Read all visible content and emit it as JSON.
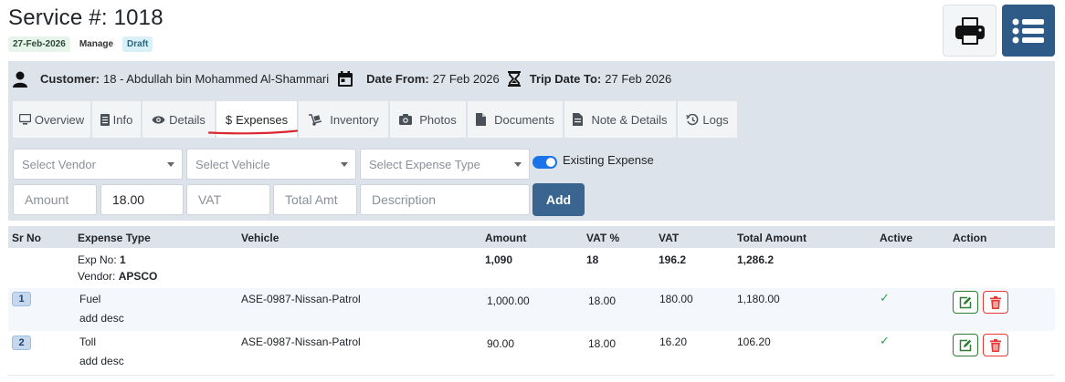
{
  "header": {
    "title": "Service #: 1018",
    "badges": {
      "date": "27-Feb-2026",
      "manage": "Manage",
      "status": "Draft"
    }
  },
  "info": {
    "customer_label": "Customer:",
    "customer_value": "18 - Abdullah bin Mohammed Al-Shammari",
    "date_from_label": "Date From:",
    "date_from_value": "27 Feb 2026",
    "trip_to_label": "Trip Date To:",
    "trip_to_value": "27 Feb 2026"
  },
  "tabs": [
    {
      "label": "Overview",
      "icon": "monitor-icon"
    },
    {
      "label": "Info",
      "icon": "document-icon"
    },
    {
      "label": "Details",
      "icon": "eye-icon"
    },
    {
      "label": "Expenses",
      "icon": "dollar-icon"
    },
    {
      "label": "Inventory",
      "icon": "dolly-icon"
    },
    {
      "label": "Photos",
      "icon": "camera-icon"
    },
    {
      "label": "Documents",
      "icon": "file-icon"
    },
    {
      "label": "Note & Details",
      "icon": "note-icon"
    },
    {
      "label": "Logs",
      "icon": "history-icon"
    }
  ],
  "form": {
    "vendor_placeholder": "Select Vendor",
    "vehicle_placeholder": "Select Vehicle",
    "expense_type_placeholder": "Select Expense Type",
    "existing_expense_label": "Existing Expense",
    "amount_placeholder": "Amount",
    "vat_percent_value": "18.00",
    "vat_placeholder": "VAT",
    "total_placeholder": "Total Amt",
    "description_placeholder": "Description",
    "add_label": "Add"
  },
  "table": {
    "columns": [
      "Sr No",
      "Expense Type",
      "Vehicle",
      "Amount",
      "VAT %",
      "VAT",
      "Total Amount",
      "Active",
      "Action"
    ],
    "group": {
      "exp_no_label": "Exp No:",
      "exp_no": "1",
      "vendor_label": "Vendor:",
      "vendor": "APSCO",
      "amount": "1,090",
      "vat_percent": "18",
      "vat": "196.2",
      "total": "1,286.2"
    },
    "rows": [
      {
        "sr": "1",
        "type": "Fuel",
        "desc": "add desc",
        "vehicle": "ASE-0987-Nissan-Patrol",
        "amount": "1,000.00",
        "vat_percent": "18.00",
        "vat": "180.00",
        "total": "1,180.00",
        "active": "✓"
      },
      {
        "sr": "2",
        "type": "Toll",
        "desc": "add desc",
        "vehicle": "ASE-0987-Nissan-Patrol",
        "amount": "90.00",
        "vat_percent": "18.00",
        "vat": "16.20",
        "total": "106.20",
        "active": "✓"
      }
    ]
  },
  "colors": {
    "primary": "#2d5a86",
    "panel": "#dde3ea",
    "success": "#28a745",
    "danger": "#e53935",
    "active_tab_underline": "#d9282f"
  }
}
